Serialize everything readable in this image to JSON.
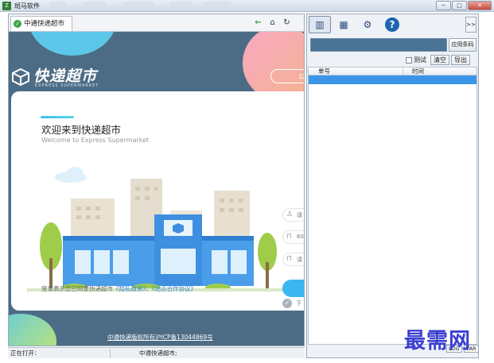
{
  "window": {
    "title": "斑马软件",
    "controls": {
      "minimize": "─",
      "maximize": "□",
      "close": "✕"
    }
  },
  "browser": {
    "tab_label": "中通快递超市",
    "nav": {
      "back": "←",
      "home": "⌂",
      "refresh": "↻"
    }
  },
  "webpage": {
    "logo_cn": "快递超市",
    "logo_en": "EXPRESS SUPERMARKET",
    "pill_text": "公",
    "welcome_cn": "欢迎来到快递超市",
    "welcome_en": "Welcome to Express Supermarket",
    "agreement_prefix": "登录表示您已同意快递超市",
    "privacy_link": "《隐私政策》",
    "agreement_sep": "、",
    "coop_link": "《站点合作协议》",
    "login_rows": [
      {
        "icon": "user-icon",
        "glyph": "♙",
        "text": "请"
      },
      {
        "icon": "lock-icon",
        "glyph": "⊓",
        "text": "60"
      },
      {
        "icon": "lock-icon",
        "glyph": "⊓",
        "text": "请"
      }
    ],
    "remember_text": "下",
    "icp_text": "中通快递版权所有沪ICP备13044869号",
    "colors": {
      "banner_bg": "#4c6c85",
      "accent_cyan": "#3cc1e8",
      "button_blue": "#3cb6f2"
    }
  },
  "statusbar": {
    "opening_label": "正在打开：",
    "page_name": "中通快递超市;"
  },
  "right_panel": {
    "toolbar": {
      "barcode_glyph": "▥",
      "chart_glyph": "▦",
      "gear_glyph": "⚙",
      "help_glyph": "?",
      "more_label": ">>"
    },
    "apply_barcode_label": "应用条码",
    "test_label": "测试",
    "clear_label": "清空",
    "export_label": "导出",
    "columns": [
      "单号",
      "时间"
    ],
    "bottom_tabs": [
      "LOG",
      "VAR"
    ]
  },
  "watermark": "最需网"
}
